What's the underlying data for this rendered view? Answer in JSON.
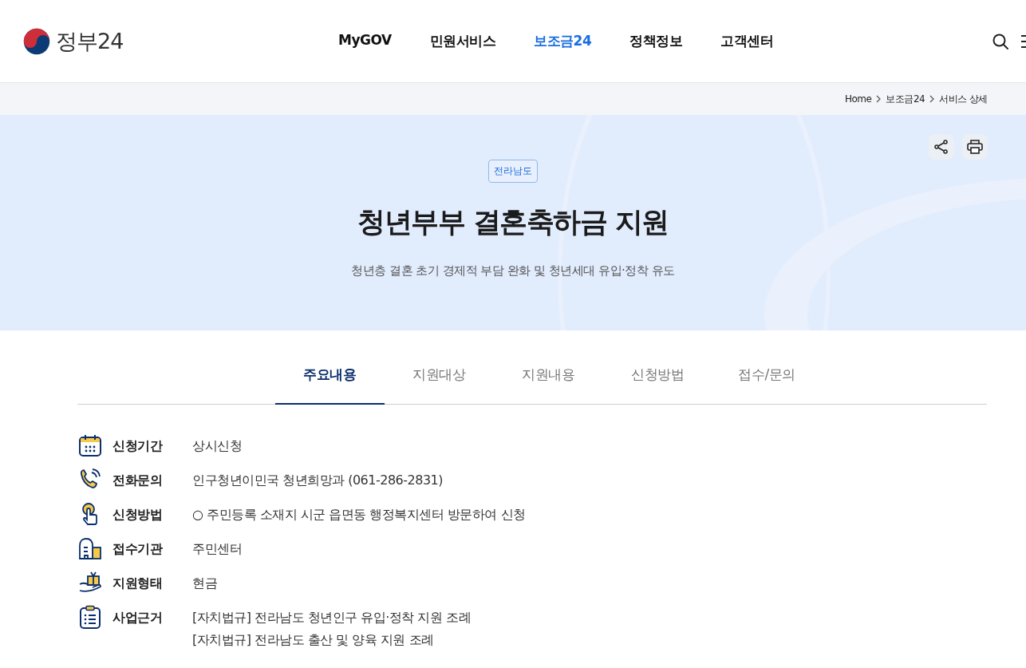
{
  "header": {
    "logo_text": "정부24",
    "nav": [
      {
        "label": "MyGOV",
        "selected": false
      },
      {
        "label": "민원서비스",
        "selected": false
      },
      {
        "label": "보조금24",
        "selected": true
      },
      {
        "label": "정책정보",
        "selected": false
      },
      {
        "label": "고객센터",
        "selected": false
      }
    ]
  },
  "breadcrumb": [
    "Home",
    "보조금24",
    "서비스 상세"
  ],
  "hero": {
    "region_tag": "전라남도",
    "title": "청년부부 결혼축하금 지원",
    "subtitle": "청년층 결혼 초기 경제적 부담 완화 및 청년세대 유입·정착 유도"
  },
  "tabs": [
    {
      "label": "주요내용",
      "selected": true
    },
    {
      "label": "지원대상",
      "selected": false
    },
    {
      "label": "지원내용",
      "selected": false
    },
    {
      "label": "신청방법",
      "selected": false
    },
    {
      "label": "접수/문의",
      "selected": false
    }
  ],
  "details": [
    {
      "label": "신청기간",
      "values": [
        "상시신청"
      ]
    },
    {
      "label": "전화문의",
      "values": [
        "인구청년이민국 청년희망과 (061-286-2831)"
      ]
    },
    {
      "label": "신청방법",
      "values": [
        "○ 주민등록 소재지 시군 읍면동 행정복지센터 방문하여 신청"
      ]
    },
    {
      "label": "접수기관",
      "values": [
        "주민센터"
      ]
    },
    {
      "label": "지원형태",
      "values": [
        "현금"
      ]
    },
    {
      "label": "사업근거",
      "values": [
        "[자치법규] 전라남도 청년인구 유입·정착 지원 조례",
        "[자치법규] 전라남도 출산 및 양육 지원 조례"
      ]
    }
  ]
}
